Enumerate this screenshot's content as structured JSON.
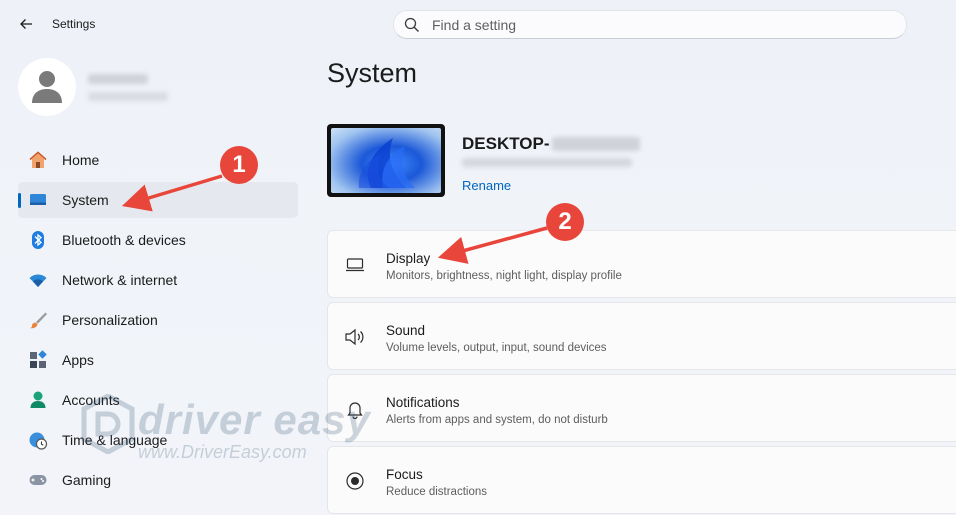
{
  "window": {
    "title": "Settings"
  },
  "search": {
    "placeholder": "Find a setting"
  },
  "sidebar": {
    "items": [
      {
        "label": "Home",
        "icon": "home-icon"
      },
      {
        "label": "System",
        "icon": "system-icon",
        "active": true
      },
      {
        "label": "Bluetooth & devices",
        "icon": "bluetooth-icon"
      },
      {
        "label": "Network & internet",
        "icon": "wifi-icon"
      },
      {
        "label": "Personalization",
        "icon": "brush-icon"
      },
      {
        "label": "Apps",
        "icon": "apps-icon"
      },
      {
        "label": "Accounts",
        "icon": "person-icon"
      },
      {
        "label": "Time & language",
        "icon": "globe-clock-icon"
      },
      {
        "label": "Gaming",
        "icon": "gamepad-icon"
      }
    ]
  },
  "main": {
    "title": "System",
    "device": {
      "name": "DESKTOP-",
      "rename_label": "Rename"
    },
    "cards": [
      {
        "title": "Display",
        "subtitle": "Monitors, brightness, night light, display profile",
        "icon": "monitor-icon"
      },
      {
        "title": "Sound",
        "subtitle": "Volume levels, output, input, sound devices",
        "icon": "speaker-icon"
      },
      {
        "title": "Notifications",
        "subtitle": "Alerts from apps and system, do not disturb",
        "icon": "bell-icon"
      },
      {
        "title": "Focus",
        "subtitle": "Reduce distractions",
        "icon": "focus-icon"
      }
    ]
  },
  "annotations": {
    "step1": "1",
    "step2": "2",
    "color": "#e8463b"
  },
  "watermark": {
    "title": "driver easy",
    "url": "www.DriverEasy.com"
  },
  "colors": {
    "accent": "#0067c0",
    "background": "#eef2f8"
  }
}
